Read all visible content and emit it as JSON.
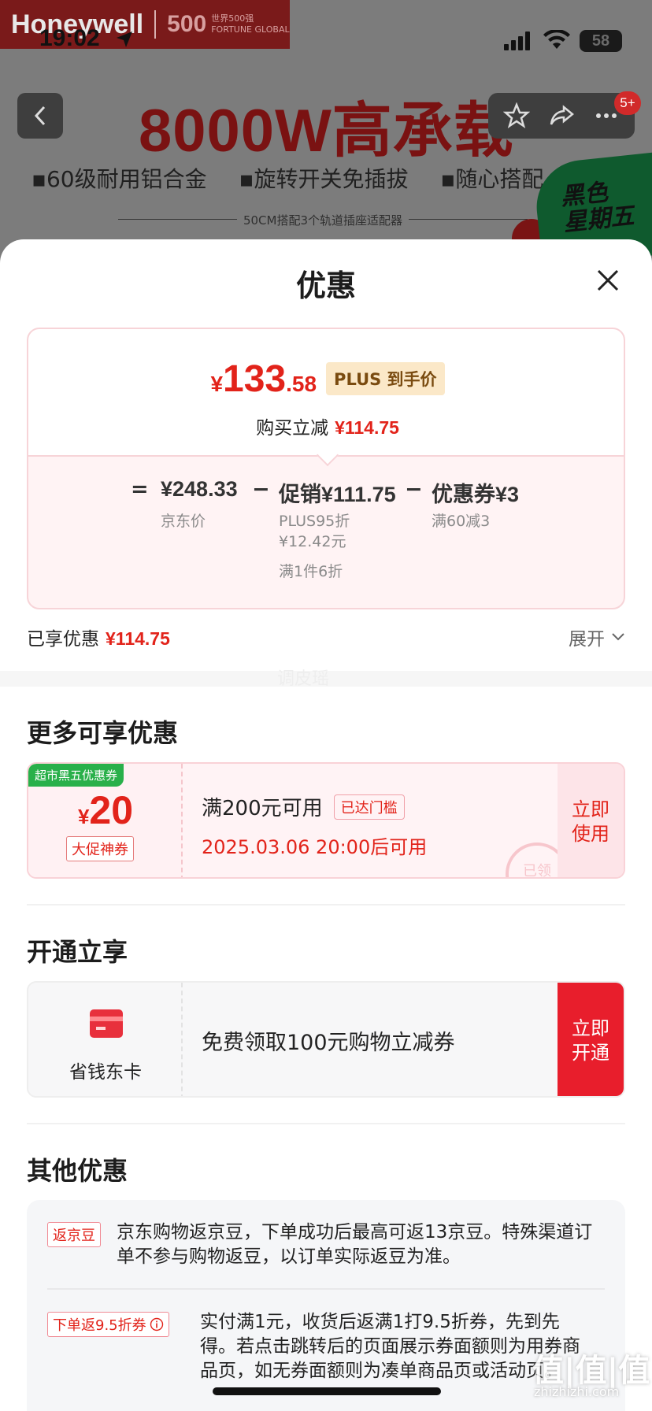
{
  "status_bar": {
    "time": "19:02",
    "battery": "58"
  },
  "product_header": {
    "brand": "Honeywell",
    "brand_badge": "500",
    "brand_badge_sub": "世界500强\nFORTUNE GLOBAL",
    "headline": "8000W高承载",
    "features": [
      "▪60级耐用铝合金",
      "▪旋转开关免插拔",
      "▪随心搭配"
    ],
    "subline": "50CM搭配3个轨道插座适配器",
    "sticker_text": "黑色\n星期五",
    "badge_count": "5+"
  },
  "sheet": {
    "title": "优惠",
    "price_card": {
      "currency": "¥",
      "price_int": "133",
      "price_dec": ".58",
      "plus_tag": "PLUS 到手价",
      "reduce_label": "购买立减",
      "reduce_amount": "¥114.75",
      "formula": {
        "eq": "=",
        "jd_price": "¥248.33",
        "jd_label": "京东价",
        "minus": "−",
        "promo_label": "促销",
        "promo_amount": "¥111.75",
        "promo_detail_1": "PLUS95折",
        "promo_detail_2": "¥12.42元",
        "promo_detail_3": "满1件6折",
        "coupon_label": "优惠券",
        "coupon_amount": "¥3",
        "coupon_detail": "满60减3"
      }
    },
    "enjoyed_label": "已享优惠",
    "enjoyed_amount": "¥114.75",
    "expand_label": "展开",
    "watermark": "调皮瑶",
    "more_title": "更多可享优惠",
    "coupon": {
      "tag": "超市黑五优惠券",
      "currency": "¥",
      "value": "20",
      "type": "大促神券",
      "condition": "满200元可用",
      "reached": "已达门槛",
      "time": "2025.03.06 20:00后可用",
      "stamp": "已领",
      "use_btn": "立即\n使用"
    },
    "member_title": "开通立享",
    "member": {
      "card_name": "省钱东卡",
      "desc": "免费领取100元购物立减券",
      "btn": "立即\n开通"
    },
    "other_title": "其他优惠",
    "other": [
      {
        "tag": "返京豆",
        "text": "京东购物返京豆，下单成功后最高可返13京豆。特殊渠道订单不参与购物返豆，以订单实际返豆为准。"
      },
      {
        "tag": "下单返9.5折券",
        "text": "实付满1元，收货后返满1打9.5折券，先到先得。若点击跳转后的页面展示券面额则为用券商品页，如无券面额则为凑单商品页或活动页。"
      }
    ],
    "corner_watermark": "值|值|值",
    "corner_watermark_sub": "zhizhizhi.com"
  }
}
